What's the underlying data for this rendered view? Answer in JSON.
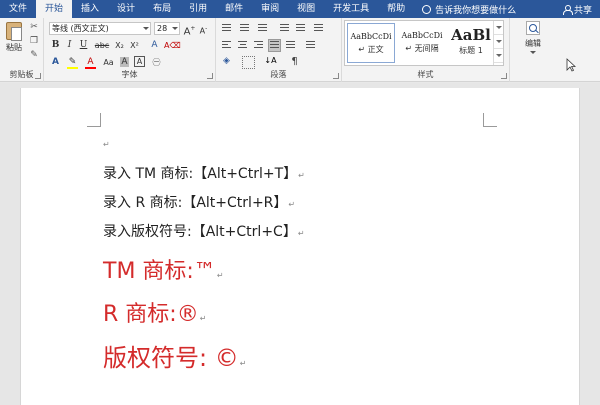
{
  "ribbon_tabs": [
    "文件",
    "开始",
    "插入",
    "设计",
    "布局",
    "引用",
    "邮件",
    "审阅",
    "视图",
    "开发工具",
    "帮助"
  ],
  "active_tab_index": 1,
  "tell_me": "告诉我你想要做什么",
  "share": "共享",
  "clipboard": {
    "paste": "粘贴",
    "group": "剪贴板"
  },
  "font": {
    "name": "等线 (西文正文)",
    "size": "28",
    "bold": "B",
    "italic": "I",
    "underline": "U",
    "strike": "abc",
    "subscript": "X₂",
    "superscript": "X²",
    "highlight_color": "#ffff00",
    "font_color_glyph": "A",
    "font_color": "#ff0000",
    "group": "字体"
  },
  "paragraph": {
    "group": "段落"
  },
  "styles": {
    "items": [
      {
        "sample": "AaBbCcDi",
        "name": "↵ 正文"
      },
      {
        "sample": "AaBbCcDi",
        "name": "↵ 无间隔"
      },
      {
        "sample": "AaBl",
        "name": "标题 1"
      }
    ],
    "group": "样式"
  },
  "editing": {
    "label": "编辑"
  },
  "document": {
    "lines": [
      "录入 TM 商标:【Alt+Ctrl+T】",
      "录入 R 商标:【Alt+Ctrl+R】",
      "录入版权符号:【Alt+Ctrl+C】",
      "TM 商标:™",
      "R 商标:®",
      "版权符号: ©"
    ],
    "paragraph_mark": "↵",
    "text_color": "#222222",
    "accent_color": "#d42b2b"
  }
}
